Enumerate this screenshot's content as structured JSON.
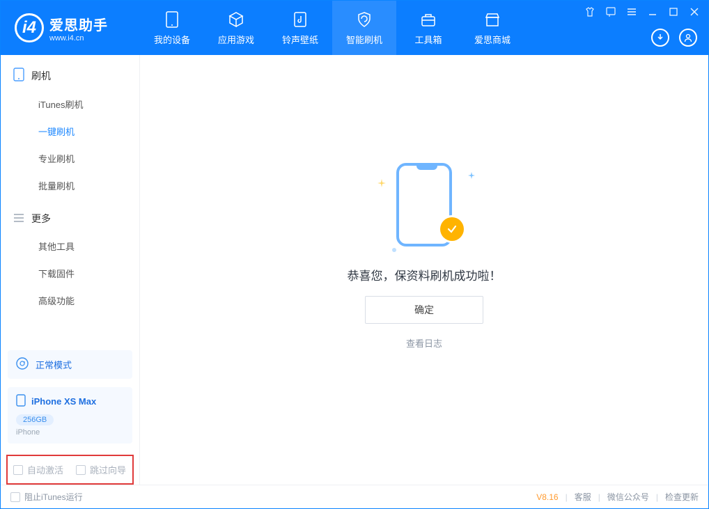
{
  "app": {
    "title": "爱思助手",
    "subtitle": "www.i4.cn"
  },
  "nav": {
    "tabs": [
      {
        "label": "我的设备"
      },
      {
        "label": "应用游戏"
      },
      {
        "label": "铃声壁纸"
      },
      {
        "label": "智能刷机"
      },
      {
        "label": "工具箱"
      },
      {
        "label": "爱思商城"
      }
    ]
  },
  "sidebar": {
    "section1": {
      "title": "刷机",
      "items": [
        "iTunes刷机",
        "一键刷机",
        "专业刷机",
        "批量刷机"
      ],
      "active_index": 1
    },
    "section2": {
      "title": "更多",
      "items": [
        "其他工具",
        "下载固件",
        "高级功能"
      ]
    },
    "mode": "正常模式",
    "device": {
      "name": "iPhone XS Max",
      "storage": "256GB",
      "type": "iPhone"
    },
    "checkboxes": {
      "auto_activate": "自动激活",
      "skip_guide": "跳过向导"
    }
  },
  "main": {
    "success_msg": "恭喜您，保资料刷机成功啦！",
    "ok_label": "确定",
    "log_link": "查看日志"
  },
  "footer": {
    "block_itunes": "阻止iTunes运行",
    "version": "V8.16",
    "links": [
      "客服",
      "微信公众号",
      "检查更新"
    ]
  }
}
